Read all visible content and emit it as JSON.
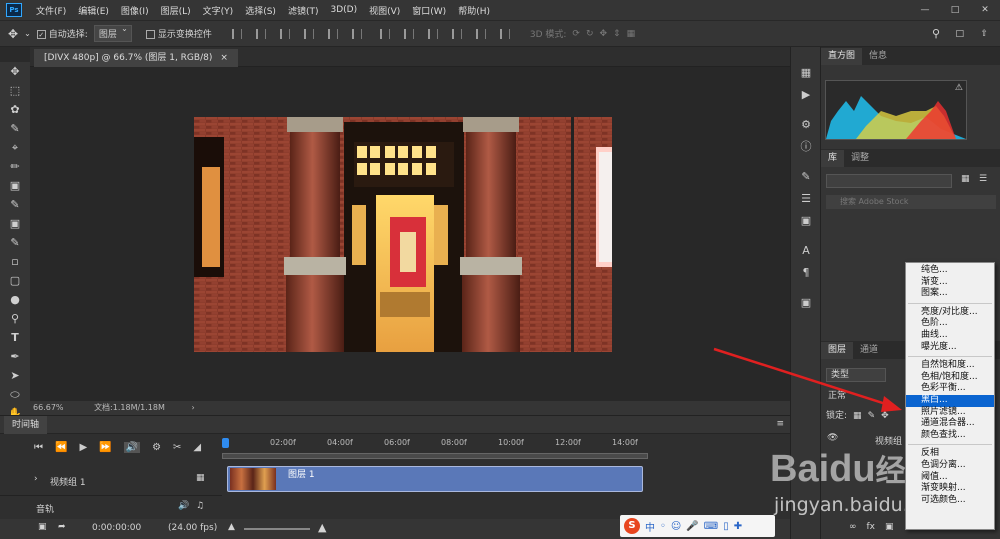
{
  "menubar": {
    "logo": "Ps",
    "items": [
      "文件(F)",
      "编辑(E)",
      "图像(I)",
      "图层(L)",
      "文字(Y)",
      "选择(S)",
      "滤镜(T)",
      "3D(D)",
      "视图(V)",
      "窗口(W)",
      "帮助(H)"
    ]
  },
  "options": {
    "auto_select_label": "自动选择:",
    "auto_select_value": "图层",
    "show_transform_label": "显示变换控件",
    "mode_3d_label": "3D 模式:"
  },
  "document": {
    "tab_title": "[DIVX 480p] @ 66.7% (图层 1, RGB/8)"
  },
  "status": {
    "zoom": "66.67%",
    "doc_size": "文档:1.18M/1.18M"
  },
  "timeline": {
    "title": "时间轴",
    "ruler": [
      "02:00f",
      "04:00f",
      "06:00f",
      "08:00f",
      "10:00f",
      "12:00f",
      "14:00f"
    ],
    "video_group": "视频组 1",
    "audio_track": "音轨",
    "clip_label": "图层 1",
    "timecode": "0:00:00:00",
    "fps": "(24.00 fps)"
  },
  "right_panel": {
    "histogram_tabs": [
      "直方图",
      "信息"
    ],
    "library_tabs": [
      "库",
      "调整"
    ],
    "search_placeholder": "搜索 Adobe Stock",
    "layers_tabs": [
      "图层",
      "通道"
    ],
    "filter_kind": "类型",
    "blend_mode": "正常",
    "lock_label": "锁定:",
    "layer_partial": "视频组"
  },
  "adjust_menu": {
    "groups": [
      [
        "纯色...",
        "渐变...",
        "图案..."
      ],
      [
        "亮度/对比度...",
        "色阶...",
        "曲线...",
        "曝光度..."
      ],
      [
        "自然饱和度...",
        "色相/饱和度...",
        "色彩平衡...",
        "黑白...",
        "照片滤镜...",
        "通道混合器...",
        "颜色查找..."
      ],
      [
        "反相",
        "色调分离...",
        "阈值...",
        "渐变映射...",
        "可选颜色..."
      ]
    ],
    "highlighted": "黑白..."
  },
  "watermark": {
    "brand": "Baidu",
    "brand_cn": "经验",
    "url": "jingyan.baidu.com"
  },
  "ime": {
    "label": "中"
  }
}
